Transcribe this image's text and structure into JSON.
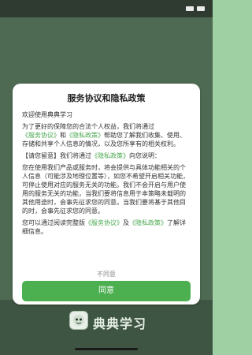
{
  "dialog": {
    "title": "服务协议和隐私政策",
    "greeting": "欢迎使用典典学习",
    "para1_pre": "为了更好的保障您的合法个人权益，我们将通过",
    "para1_link1": "《服务协议》",
    "para1_mid": "和",
    "para1_link2": "《隐私政策》",
    "para1_post": "帮助您了解我们收集、使用、存储和共享个人信息的情况，以及您所享有的相关权利。",
    "para2_pre": "【请您留意】我们将通过",
    "para2_link": "《隐私政策》",
    "para2_post": "向您说明：",
    "para3": "您在使用我们产品或服务时，将会提供与具体功能相关的个人信息（可能涉及地理位置等），如您不希望开启相关功能，可停止使用对应的服务无关的功能。我们不会开启与用户使用的服务无关的功能，当我们要将信息用于本策略未载明的其他用途时，会事先征求您的同意。当我们要将基于其他目的时，会事先征求您的同意。",
    "para4_pre": "您可以通过阅读完整版",
    "para4_link1": "《服务协议》",
    "para4_mid": "及",
    "para4_link2": "《隐私政策》",
    "para4_post": "了解详细信息。",
    "decline_label": "不同意",
    "agree_label": "同意"
  },
  "background": {
    "brand": "典典学习"
  },
  "colors": {
    "accent": "#4caf50",
    "link": "#4aa84f",
    "overlay": "#4f6a52"
  }
}
